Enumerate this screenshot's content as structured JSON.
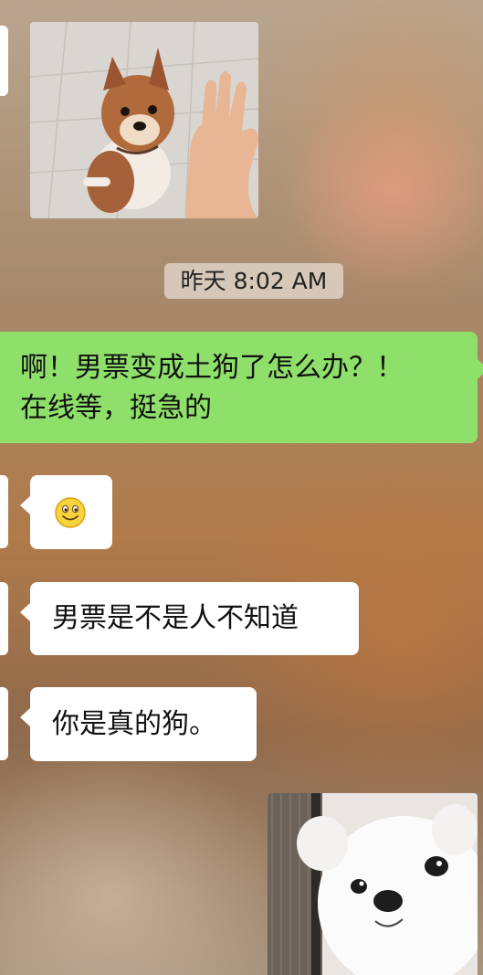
{
  "chat": {
    "timestamp": "昨天 8:02 AM",
    "messages": [
      {
        "sender": "self",
        "text": "啊！男票变成土狗了怎么办？！\n在线等，挺急的"
      },
      {
        "sender": "other",
        "type": "emoji",
        "emoji": "smiley"
      },
      {
        "sender": "other",
        "text": "男票是不是人不知道"
      },
      {
        "sender": "other",
        "text": "你是真的狗。"
      }
    ],
    "images": [
      {
        "sender": "other",
        "subject": "shiba-puppy-high-five-photo"
      },
      {
        "sender": "self",
        "subject": "white-pomeranian-photo"
      }
    ]
  },
  "colors": {
    "self_bubble": "#8fe06a",
    "other_bubble": "#ffffff"
  }
}
